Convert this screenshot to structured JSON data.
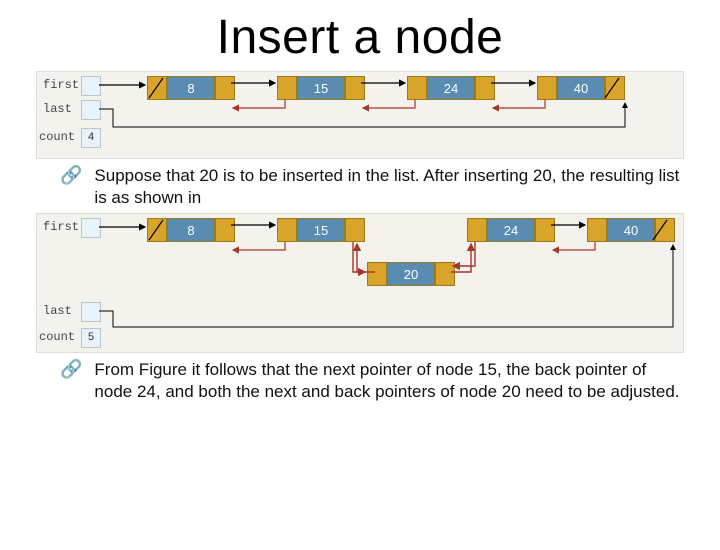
{
  "title": "Insert a node",
  "bullet1": "Suppose that 20 is to be inserted in the list. After inserting 20, the resulting list is as shown in",
  "bullet2": "From Figure it follows that the next pointer of node 15, the back pointer of node 24, and both the next and back pointers of node 20 need to be adjusted.",
  "fig1": {
    "first_label": "first",
    "last_label": "last",
    "count_label": "count",
    "count_value": "4",
    "nodes": [
      "8",
      "15",
      "24",
      "40"
    ]
  },
  "fig2": {
    "first_label": "first",
    "last_label": "last",
    "count_label": "count",
    "count_value": "5",
    "nodes_top": [
      "8",
      "15",
      "24",
      "40"
    ],
    "node_mid": "20"
  },
  "chart_data": [
    {
      "type": "other",
      "description": "doubly linked list before insert",
      "first": "8",
      "last": "40",
      "count": 4,
      "nodes": [
        8,
        15,
        24,
        40
      ]
    },
    {
      "type": "other",
      "description": "doubly linked list after inserting 20",
      "first": "8",
      "last": "40",
      "count": 5,
      "nodes": [
        8,
        15,
        20,
        24,
        40
      ]
    }
  ]
}
